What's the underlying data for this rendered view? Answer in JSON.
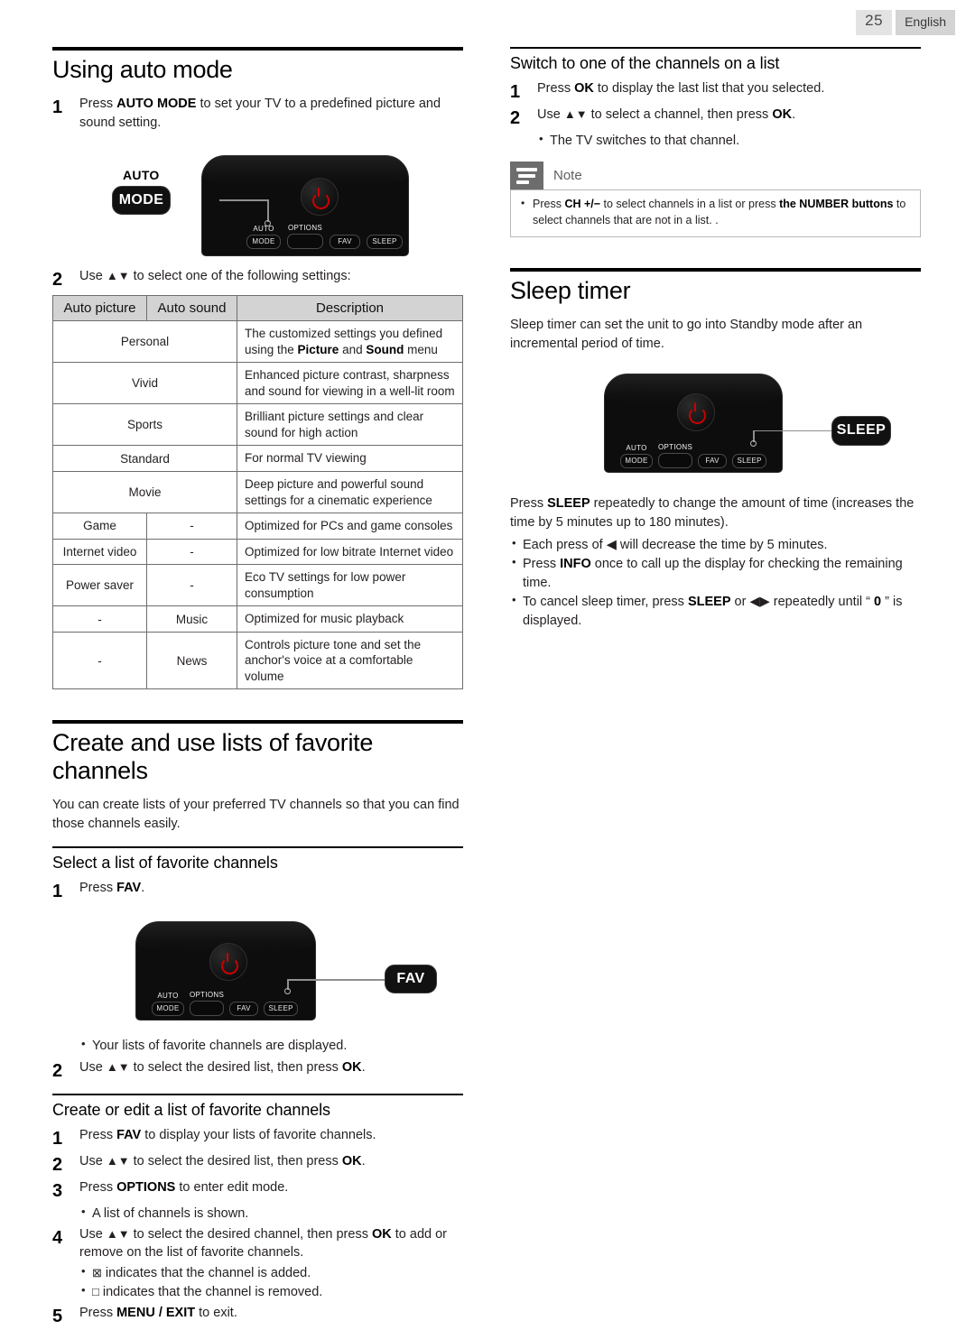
{
  "page": {
    "number": "25",
    "language": "English"
  },
  "left_column": {
    "section_auto_mode": {
      "title": "Using auto mode",
      "step1": {
        "num": "1",
        "text_a": "Press ",
        "bold": "AUTO MODE",
        "text_b": " to set your TV to a predefined picture and sound setting."
      },
      "remote": {
        "callout_top_label": "AUTO",
        "callout_button": "MODE",
        "buttons": [
          "AUTO",
          "MODE",
          "OPTIONS",
          "FAV",
          "SLEEP"
        ],
        "power_icon": "power-icon"
      },
      "step2": {
        "num": "2",
        "text_a": "Use ",
        "arrows": "▲▼",
        "text_b": " to select one of the following settings:"
      }
    },
    "settings_table": {
      "headers": [
        "Auto picture",
        "Auto sound",
        "Description"
      ],
      "rows": [
        {
          "picture": "Personal",
          "sound": "",
          "merged": true,
          "description": "The customized settings you defined using the Picture and Sound menu",
          "desc_parts": [
            {
              "t": "The customized settings you defined using the ",
              "b": false
            },
            {
              "t": "Picture",
              "b": true
            },
            {
              "t": " and ",
              "b": false
            },
            {
              "t": "Sound",
              "b": true
            },
            {
              "t": " menu",
              "b": false
            }
          ]
        },
        {
          "picture": "Vivid",
          "sound": "",
          "merged": true,
          "description": "Enhanced picture contrast, sharpness and sound for viewing in a well-lit room"
        },
        {
          "picture": "Sports",
          "sound": "",
          "merged": true,
          "description": "Brilliant picture settings and clear sound for high action"
        },
        {
          "picture": "Standard",
          "sound": "",
          "merged": true,
          "description": "For normal TV viewing"
        },
        {
          "picture": "Movie",
          "sound": "",
          "merged": true,
          "description": "Deep picture and powerful sound settings for a cinematic experience"
        },
        {
          "picture": "Game",
          "sound": "-",
          "merged": false,
          "description": "Optimized for PCs and game consoles"
        },
        {
          "picture": "Internet video",
          "sound": "-",
          "merged": false,
          "description": "Optimized for low bitrate Internet video"
        },
        {
          "picture": "Power saver",
          "sound": "-",
          "merged": false,
          "description": "Eco TV settings for low power consumption"
        },
        {
          "picture": "-",
          "sound": "Music",
          "merged": false,
          "description": "Optimized for music playback"
        },
        {
          "picture": "-",
          "sound": "News",
          "merged": false,
          "description": "Controls picture tone and set the anchor's voice at a comfortable volume"
        }
      ]
    },
    "section_favorites": {
      "title": "Create and use lists of favorite channels",
      "intro": "You can create lists of your preferred TV channels so that you can find those channels easily.",
      "select_list": {
        "title": "Select a list of favorite channels",
        "step1": {
          "num": "1",
          "text_a": "Press ",
          "bold": "FAV",
          "text_b": "."
        },
        "remote": {
          "callout_button": "FAV",
          "buttons": [
            "AUTO",
            "MODE",
            "OPTIONS",
            "FAV",
            "SLEEP"
          ]
        },
        "bullet1": "Your lists of favorite channels are displayed.",
        "step2": {
          "num": "2",
          "text_a": "Use ",
          "arrows": "▲▼",
          "text_b": " to select the desired list, then press ",
          "bold": "OK",
          "text_c": "."
        }
      },
      "create_edit": {
        "title": "Create or edit a list of favorite channels",
        "step1": {
          "num": "1",
          "text_a": "Press ",
          "bold": "FAV",
          "text_b": " to display your lists of favorite channels."
        },
        "step2": {
          "num": "2",
          "text_a": "Use ",
          "arrows": "▲▼",
          "text_b": " to select the desired list, then press ",
          "bold": "OK",
          "text_c": "."
        },
        "step3": {
          "num": "3",
          "text_a": "Press ",
          "bold": "OPTIONS",
          "text_b": " to enter edit mode."
        },
        "bullet3": "A list of channels is shown.",
        "step4": {
          "num": "4",
          "text_a": "Use ",
          "arrows": "▲▼",
          "text_b": " to select the desired channel, then press ",
          "bold": "OK",
          "text_c": " to add or remove on the list of favorite channels."
        },
        "bullet4a_icon": "⊠",
        "bullet4a": " indicates that the channel is added.",
        "bullet4b_icon": "□",
        "bullet4b": " indicates that the channel is removed.",
        "step5": {
          "num": "5",
          "text_a": "Press ",
          "bold": "MENU / EXIT",
          "text_b": " to exit."
        }
      }
    }
  },
  "right_column": {
    "switch_channels": {
      "title": "Switch to one of the channels on a list",
      "step1": {
        "num": "1",
        "text_a": "Press ",
        "bold": "OK",
        "text_b": " to display the last list that you selected."
      },
      "step2": {
        "num": "2",
        "text_a": "Use ",
        "arrows": "▲▼",
        "text_b": " to select a channel, then press ",
        "bold": "OK",
        "text_c": "."
      },
      "bullet1": "The TV switches to that channel."
    },
    "note": {
      "icon": "note-lines-icon",
      "title": "Note",
      "items": [
        {
          "parts": [
            {
              "t": "Press ",
              "b": false
            },
            {
              "t": "CH +/−",
              "b": true
            },
            {
              "t": " to select channels in a list or press ",
              "b": false
            },
            {
              "t": "the NUMBER buttons",
              "b": true
            },
            {
              "t": " to select channels that are not in a list. .",
              "b": false
            }
          ]
        }
      ]
    },
    "sleep_timer": {
      "title": "Sleep timer",
      "intro": "Sleep timer can set the unit to go into Standby mode after an incremental period of time.",
      "remote": {
        "callout_button": "SLEEP",
        "buttons": [
          "AUTO",
          "MODE",
          "OPTIONS",
          "FAV",
          "SLEEP"
        ]
      },
      "para_parts": [
        {
          "t": "Press ",
          "b": false
        },
        {
          "t": "SLEEP",
          "b": true
        },
        {
          "t": " repeatedly to change the amount of time (increases the time by 5 minutes up to 180 minutes).",
          "b": false
        }
      ],
      "bullets": [
        {
          "parts": [
            {
              "t": "Each press of ",
              "b": false
            },
            {
              "t": "◀",
              "b": false,
              "arrow": true
            },
            {
              "t": " will decrease the time by 5 minutes.",
              "b": false
            }
          ]
        },
        {
          "parts": [
            {
              "t": "Press ",
              "b": false
            },
            {
              "t": "INFO",
              "b": true
            },
            {
              "t": " once to call up the display for checking the remaining time.",
              "b": false
            }
          ]
        },
        {
          "parts": [
            {
              "t": "To cancel sleep timer, press ",
              "b": false
            },
            {
              "t": "SLEEP",
              "b": true
            },
            {
              "t": " or ",
              "b": false
            },
            {
              "t": "◀▶",
              "b": false,
              "arrow": true
            },
            {
              "t": " repeatedly until “ ",
              "b": false
            },
            {
              "t": "0",
              "b": true
            },
            {
              "t": " ” is displayed.",
              "b": false
            }
          ]
        }
      ]
    }
  }
}
